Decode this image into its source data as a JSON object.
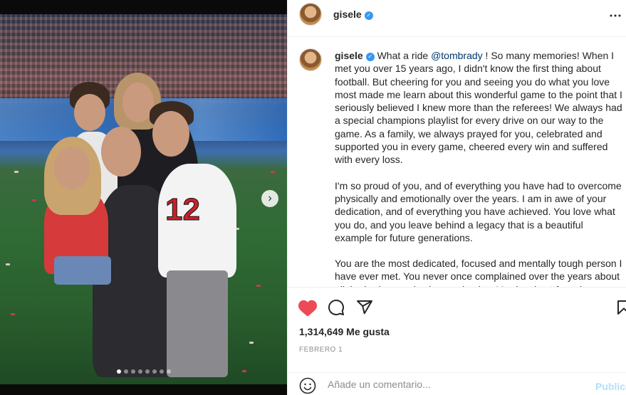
{
  "post": {
    "username": "gisele",
    "verified_badge_icon": "verified-check-icon",
    "more_icon": "more-options-icon"
  },
  "caption": {
    "username": "gisele",
    "intro": "What a ride",
    "mention": "@tombrady",
    "paragraph1_rest": "! So many memories! When I met you over 15 years ago, I didn't know the first thing about football. But cheering for you and seeing you do what you love most made me learn about this wonderful game to the point that I seriously believed I knew more than the referees! We always had a special champions playlist for every drive on our way to the game. As a family, we always prayed for you, celebrated and supported you in every game, cheered every win and suffered with every loss.",
    "paragraph2": "I'm so proud of you, and of everything you have had to overcome physically and emotionally over the years. I am in awe of your dedication, and of everything you have achieved. You love what you do, and you leave behind a legacy that is a beautiful example for future generations.",
    "paragraph3": "You are the most dedicated, focused and mentally tough person I have ever met. You never once complained over the years about all the bruises and aches and pains. You just kept focusing on"
  },
  "actions": {
    "like_icon": "heart-filled-icon",
    "comment_icon": "comment-icon",
    "share_icon": "share-icon",
    "save_icon": "bookmark-icon",
    "like_color": "#ed4956"
  },
  "stats": {
    "likes": "1,314,649 Me gusta",
    "date": "FEBRERO 1"
  },
  "comment": {
    "placeholder": "Añade un comentario...",
    "publish_label": "Publicar",
    "emoji_icon": "emoji-icon"
  },
  "carousel": {
    "next_icon": "chevron-right-icon",
    "slide_count": 8,
    "active_slide": 1
  }
}
